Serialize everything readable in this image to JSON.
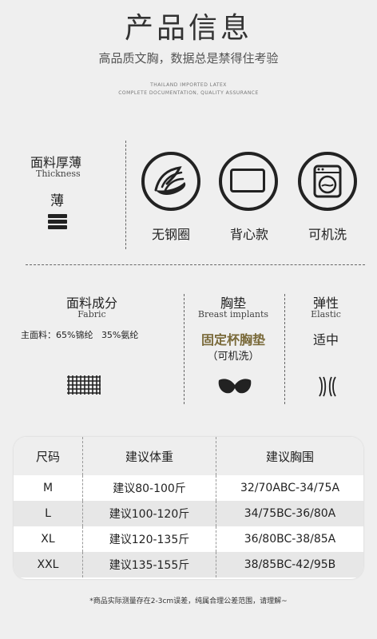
{
  "header": {
    "title": "产品信息",
    "subtitle": "高品质文胸，数据总是禁得住考验",
    "tagline1": "THAILAND IMPORTED LATEX",
    "tagline2": "COMPLETE DOCUMENTATION, QUALITY ASSURANCE"
  },
  "thickness": {
    "label_cn": "面料厚薄",
    "label_en": "Thickness",
    "value": "薄"
  },
  "features": [
    {
      "label": "无钢圈",
      "icon": "no-underwire-icon"
    },
    {
      "label": "背心款",
      "icon": "vest-style-icon"
    },
    {
      "label": "可机洗",
      "icon": "washing-machine-icon"
    }
  ],
  "fabric": {
    "label_cn": "面料成分",
    "label_en": "Fabric",
    "detail": "主面料：65%锦纶   35%氨纶"
  },
  "pad": {
    "label_cn": "胸垫",
    "label_en": "Breast implants",
    "value": "固定杯胸垫",
    "note": "（可机洗）",
    "accent": "#7a6a3a"
  },
  "elastic": {
    "label_cn": "弹性",
    "label_en": "Elastic",
    "value": "适中"
  },
  "size_table": {
    "headers": [
      "尺码",
      "建议体重",
      "建议胸围"
    ],
    "rows": [
      [
        "M",
        "建议80-100斤",
        "32/70ABC-34/75A"
      ],
      [
        "L",
        "建议100-120斤",
        "34/75BC-36/80A"
      ],
      [
        "XL",
        "建议120-135斤",
        "36/80BC-38/85A"
      ],
      [
        "XXL",
        "建议135-155斤",
        "38/85BC-42/95B"
      ]
    ]
  },
  "footnote": "*商品实际测量存在2-3cm误差，纯属合理公差范围，请理解~"
}
